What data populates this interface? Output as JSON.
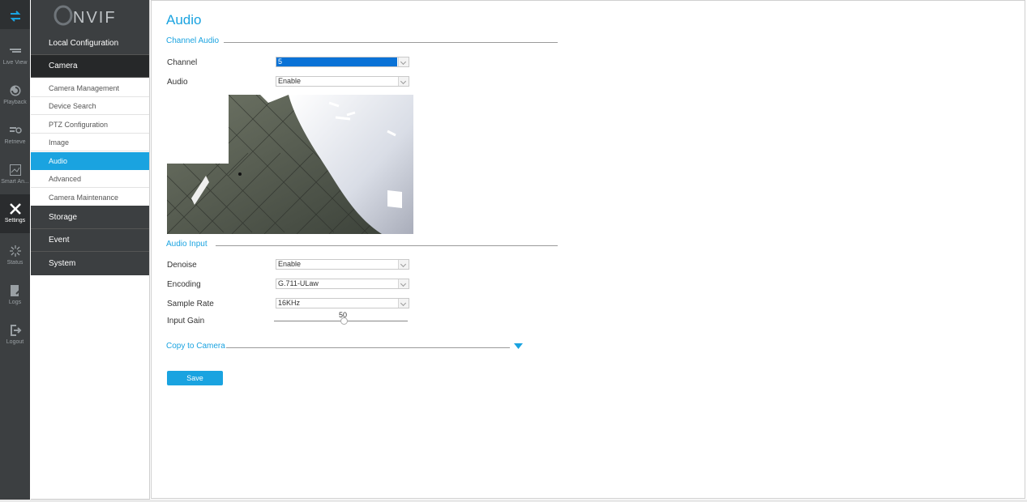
{
  "rail": {
    "items": [
      {
        "label": "",
        "icon": "switch-arrows-icon"
      },
      {
        "label": "Live View",
        "icon": "live-view-icon"
      },
      {
        "label": "Playback",
        "icon": "playback-icon"
      },
      {
        "label": "Retrieve",
        "icon": "retrieve-icon"
      },
      {
        "label": "Smart An...",
        "icon": "smart-analytics-icon"
      },
      {
        "label": "Settings",
        "icon": "settings-icon"
      },
      {
        "label": "Status",
        "icon": "status-icon"
      },
      {
        "label": "Logs",
        "icon": "logs-icon"
      },
      {
        "label": "Logout",
        "icon": "logout-icon"
      }
    ]
  },
  "logo_text": "ONVIF",
  "menu": {
    "local_configuration": "Local Configuration",
    "camera": "Camera",
    "camera_items": [
      {
        "label": "Camera Management"
      },
      {
        "label": "Device Search"
      },
      {
        "label": "PTZ Configuration"
      },
      {
        "label": "Image"
      },
      {
        "label": "Audio"
      },
      {
        "label": "Advanced"
      },
      {
        "label": "Camera Maintenance"
      }
    ],
    "storage": "Storage",
    "event": "Event",
    "system": "System"
  },
  "page": {
    "title": "Audio",
    "channel_audio_section": "Channel Audio",
    "channel_label": "Channel",
    "channel_value": "5",
    "audio_label": "Audio",
    "audio_value": "Enable",
    "audio_input_section": "Audio Input",
    "denoise_label": "Denoise",
    "denoise_value": "Enable",
    "encoding_label": "Encoding",
    "encoding_value": "G.711-ULaw",
    "sample_rate_label": "Sample Rate",
    "sample_rate_value": "16KHz",
    "input_gain_label": "Input Gain",
    "input_gain_value": "50",
    "copy_section": "Copy to Camera",
    "save_label": "Save"
  },
  "colors": {
    "accent": "#1aa3e0",
    "rail_bg": "#3c3f41",
    "active_head": "#262829"
  }
}
